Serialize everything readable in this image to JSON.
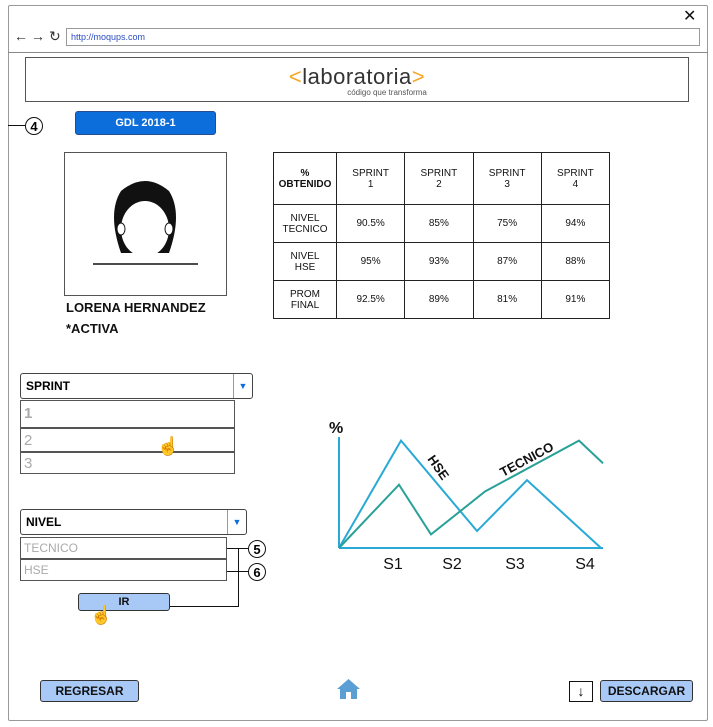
{
  "browser": {
    "url": "http://moqups.com",
    "close_icon": "close-icon"
  },
  "logo": {
    "left_bracket": "<",
    "name": "laboratoria",
    "right_bracket": ">",
    "tagline": "código que transforma"
  },
  "group_button": {
    "label": "GDL 2018-1"
  },
  "annotations": {
    "n4": "4",
    "n5": "5",
    "n6": "6"
  },
  "student": {
    "name": "LORENA HERNANDEZ",
    "status": "*ACTIVA"
  },
  "grades_table": {
    "header": [
      "%\nOBTENIDO",
      "SPRINT\n1",
      "SPRINT\n2",
      "SPRINT\n3",
      "SPRINT\n4"
    ],
    "rows": [
      [
        "NIVEL\nTECNICO",
        "90.5%",
        "85%",
        "75%",
        "94%"
      ],
      [
        "NIVEL\nHSE",
        "95%",
        "93%",
        "87%",
        "88%"
      ],
      [
        "PROM\nFINAL",
        "92.5%",
        "89%",
        "81%",
        "91%"
      ]
    ]
  },
  "sprint_select": {
    "label": "SPRINT",
    "options": [
      "1",
      "2",
      "3"
    ]
  },
  "level_select": {
    "label": "NIVEL",
    "options": [
      "TECNICO",
      "HSE"
    ]
  },
  "go_button": {
    "label": "IR"
  },
  "footer": {
    "back_label": "REGRESAR",
    "download_label": "DESCARGAR"
  },
  "colors": {
    "accent": "#0c6edb",
    "light_button": "#a8c9f5",
    "hse_line": "#29a9d6",
    "tecnico_line": "#2aa198",
    "logo_bracket": "#f6a623",
    "home_icon": "#5a9fd4"
  },
  "chart_data": {
    "type": "line",
    "ylabel": "%",
    "categories": [
      "S1",
      "S2",
      "S3",
      "S4"
    ],
    "series": [
      {
        "name": "HSE",
        "values": [
          0,
          95,
          15,
          60,
          0
        ]
      },
      {
        "name": "TECNICO",
        "values": [
          0,
          56,
          12,
          50,
          95,
          75
        ]
      }
    ]
  }
}
